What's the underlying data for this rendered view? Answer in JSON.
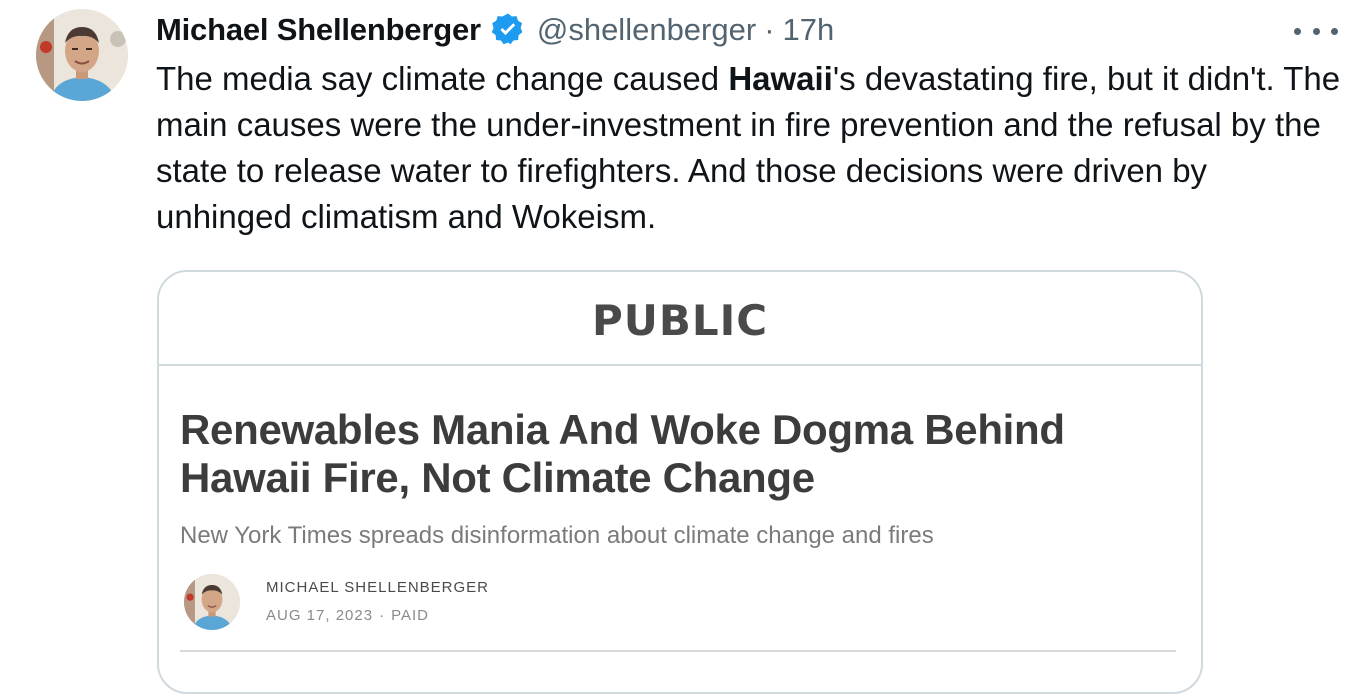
{
  "tweet": {
    "display_name": "Michael Shellenberger",
    "verified_icon": "verified-badge-icon",
    "handle": "@shellenberger",
    "separator": "·",
    "timestamp": "17h",
    "more_icon": "more-options-icon",
    "text": {
      "part1": "The media say climate change caused ",
      "bold": "Hawaii",
      "part2": "'s devastating fire, but it didn't. The main causes were the under-investment in fire prevention and the refusal by the state to release water to firefighters. And those decisions were driven by unhinged climatism and Wokeism."
    }
  },
  "card": {
    "publication": "PUBLIC",
    "headline": "Renewables Mania And Woke Dogma Behind Hawaii Fire, Not Climate Change",
    "subtitle": "New York Times spreads disinformation about climate change and fires",
    "author": "MICHAEL SHELLENBERGER",
    "date": "AUG 17, 2023",
    "meta_separator": "·",
    "access": "PAID"
  },
  "colors": {
    "verified_blue": "#1d9bf0",
    "secondary_text": "#536471",
    "border": "#cfd9de"
  }
}
